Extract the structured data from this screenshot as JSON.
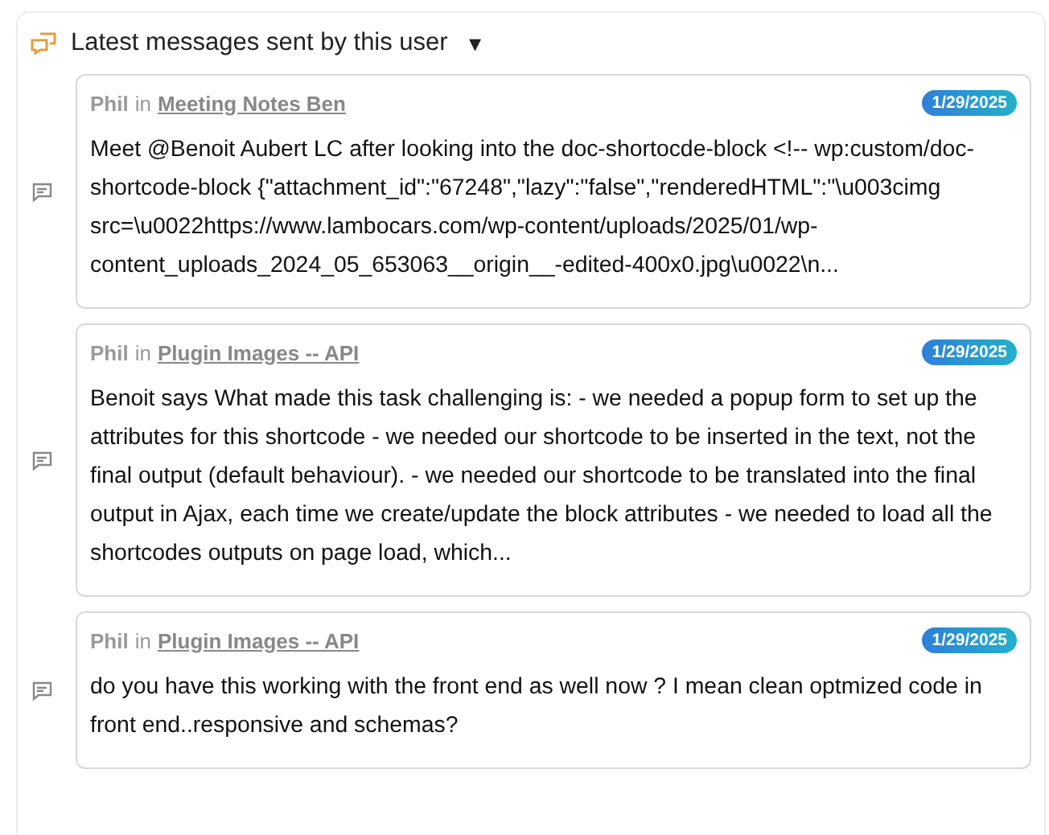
{
  "header": {
    "title": "Latest messages sent by this user",
    "caret": "▾"
  },
  "messages": [
    {
      "author": "Phil",
      "preposition": "in",
      "channel": "Meeting Notes Ben",
      "date": "1/29/2025",
      "text": "Meet @Benoit Aubert LC after looking into the doc-shortocde-block <!-- wp:custom/doc-shortcode-block {\"attachment_id\":\"67248\",\"lazy\":\"false\",\"renderedHTML\":\"\\u003cimg src=\\u0022https://www.lambocars.com/wp-content/uploads/2025/01/wp-content_uploads_2024_05_653063__origin__-edited-400x0.jpg\\u0022\\n..."
    },
    {
      "author": "Phil",
      "preposition": "in",
      "channel": "Plugin Images -- API",
      "date": "1/29/2025",
      "text": "Benoit says What made this task challenging is: - we needed a popup form to set up the attributes for this shortcode - we needed our shortcode to be inserted in the text, not the final output (default behaviour). - we needed our shortcode to be translated into the final output in Ajax, each time we create/update the block attributes - we needed to load all the shortcodes outputs on page load, which..."
    },
    {
      "author": "Phil",
      "preposition": "in",
      "channel": "Plugin Images -- API",
      "date": "1/29/2025",
      "text": "do you have this working with the front end as well now ? I mean clean optmized code in front end..responsive and schemas?"
    }
  ]
}
